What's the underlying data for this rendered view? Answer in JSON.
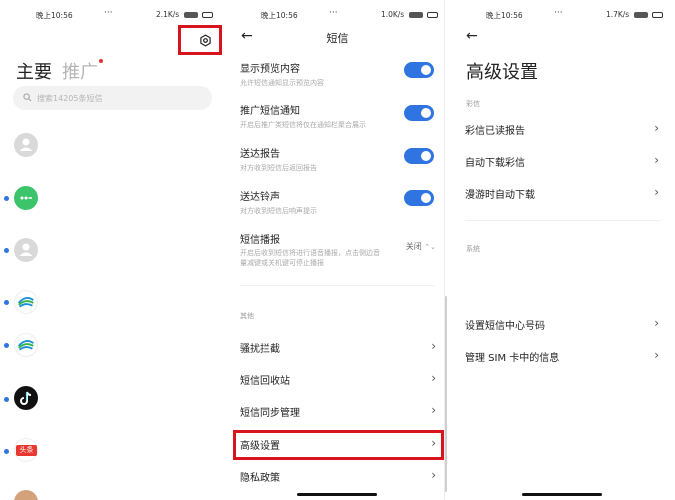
{
  "status": {
    "time": "晚上10:56",
    "panel1_speed": "2.1K/s",
    "panel2_speed": "1.0K/s",
    "panel3_speed": "1.7K/s",
    "more": "···"
  },
  "panel1": {
    "tab_main": "主要",
    "tab_promo": "推广",
    "search_placeholder": "搜索14205条短信",
    "conversations": [
      {
        "icon": "default-avatar-icon",
        "color": "#d9d9d9"
      },
      {
        "icon": "chat-bubble-avatar-icon",
        "color": "#3cc46a"
      },
      {
        "icon": "default-avatar-icon",
        "color": "#d9d9d9"
      },
      {
        "icon": "china-mobile-logo-icon",
        "color": "#1a8fd8"
      },
      {
        "icon": "china-mobile-logo-icon",
        "color": "#1a8fd8"
      },
      {
        "icon": "tiktok-logo-icon",
        "color": "#111111"
      },
      {
        "icon": "toutiao-logo-icon",
        "color": "#e8382f",
        "text": "头条"
      },
      {
        "icon": "photo-avatar-icon",
        "color": "#d4a27a"
      }
    ]
  },
  "panel2": {
    "title": "短信",
    "rows": [
      {
        "title": "显示预览内容",
        "sub": "允许短信通知显示预览内容",
        "toggle": "on"
      },
      {
        "title": "推广短信通知",
        "sub": "开启后推广类短信将仅在通知栏聚合展示",
        "toggle": "on"
      },
      {
        "title": "送达报告",
        "sub": "对方收到短信后返回报告",
        "toggle": "on"
      },
      {
        "title": "送达铃声",
        "sub": "对方收到短信后响声提示",
        "toggle": "on"
      }
    ],
    "broadcast": {
      "title": "短信播报",
      "sub1": "开启后收到短信将进行语音播报，点击侧边音",
      "sub2": "量减键或关机键可停止播报",
      "value": "关闭"
    },
    "section_other": "其他",
    "items": [
      "骚扰拦截",
      "短信回收站",
      "短信同步管理",
      "高级设置",
      "隐私政策"
    ]
  },
  "panel3": {
    "title": "高级设置",
    "section_mms": "彩信",
    "mms_items": [
      "彩信已读报告",
      "自动下载彩信",
      "漫游时自动下载"
    ],
    "section_system": "系统",
    "system_items": [
      "设置短信中心号码",
      "管理 SIM 卡中的信息"
    ]
  },
  "colors": {
    "accent": "#2f74e0",
    "highlight": "#d8151d"
  }
}
